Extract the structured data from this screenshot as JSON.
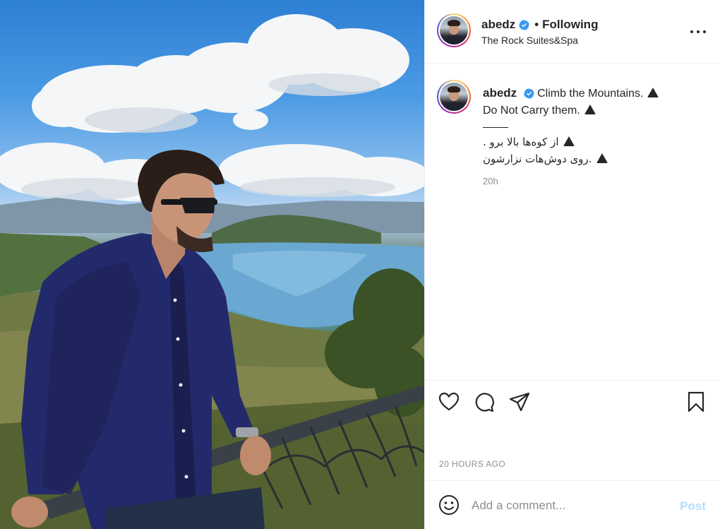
{
  "post": {
    "username": "abedz",
    "following_label": "Following",
    "location": "The Rock Suites&Spa",
    "caption": {
      "line1": "Climb the Mountains.",
      "line2": "Do Not Carry them.",
      "fa_line1": ". از کوه‌ها بالا برو",
      "fa_line2": "روی دوش‌هات نزارشون."
    },
    "relative_time": "20h",
    "timestamp": "20 HOURS AGO"
  },
  "comment": {
    "placeholder": "Add a comment...",
    "post_label": "Post"
  },
  "colors": {
    "verified": "#3897f0",
    "post_button_disabled": "#b2dffc",
    "muted_text": "#8e8e8e"
  },
  "icons": [
    "verified-badge-icon",
    "more-options-icon",
    "heart-icon",
    "comment-icon",
    "share-icon",
    "bookmark-icon",
    "emoji-icon",
    "mountain-emoji"
  ]
}
